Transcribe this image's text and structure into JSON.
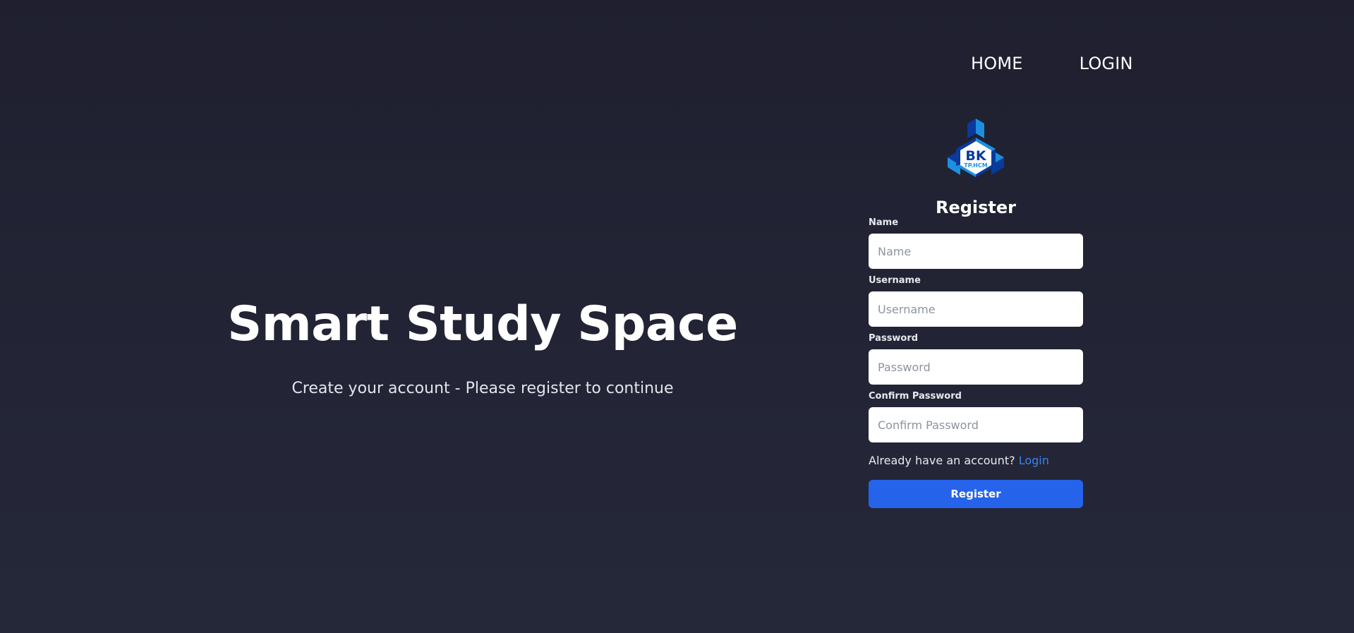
{
  "nav": {
    "home_label": "HOME",
    "login_label": "LOGIN"
  },
  "hero": {
    "title": "Smart Study Space",
    "subtitle": "Create your account - Please register to continue"
  },
  "logo": {
    "text_main": "BK",
    "text_sub": "TP.HCM",
    "colors": {
      "dark_blue": "#0a3a9c",
      "light_blue": "#1e8fe0",
      "white": "#ffffff"
    }
  },
  "form": {
    "title": "Register",
    "fields": [
      {
        "label": "Name",
        "placeholder": "Name",
        "value": ""
      },
      {
        "label": "Username",
        "placeholder": "Username",
        "value": ""
      },
      {
        "label": "Password",
        "placeholder": "Password",
        "value": ""
      },
      {
        "label": "Confirm Password",
        "placeholder": "Confirm Password",
        "value": ""
      }
    ],
    "login_prompt": "Already have an account?",
    "login_link": "Login",
    "submit_label": "Register"
  },
  "colors": {
    "background": "#222435",
    "accent": "#2563eb",
    "link": "#3b82f6"
  }
}
